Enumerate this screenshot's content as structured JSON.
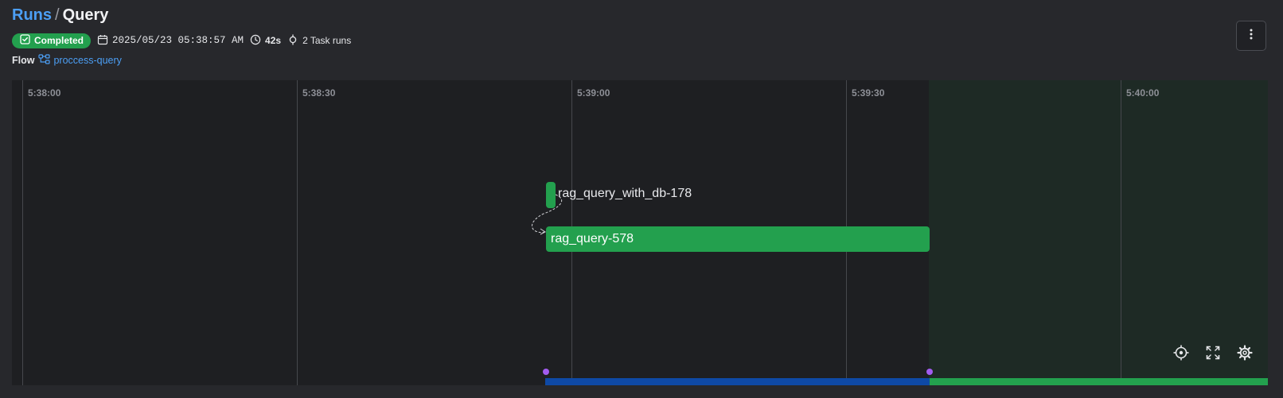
{
  "breadcrumb": {
    "parent": "Runs",
    "separator": "/",
    "current": "Query"
  },
  "run": {
    "state": "Completed",
    "start_time": "2025/05/23 05:38:57 AM",
    "duration": "42s",
    "task_runs": "2 Task runs"
  },
  "flow": {
    "label": "Flow",
    "name": "proccess-query"
  },
  "timeline": {
    "ticks": [
      "5:38:00",
      "5:38:30",
      "5:39:00",
      "5:39:30",
      "5:40:00"
    ],
    "nodes": [
      {
        "name": "rag_query_with_db-178",
        "state": "Completed"
      },
      {
        "name": "rag_query-578",
        "state": "Completed"
      }
    ]
  },
  "icons": {
    "badge": "check-square-icon",
    "date": "calendar-icon",
    "duration": "clock-icon",
    "tasks": "task-run-icon",
    "flow": "flow-icon",
    "menu": "kebab-menu-icon",
    "recenter": "crosshair-icon",
    "fullscreen": "fullscreen-icon",
    "settings": "gear-icon"
  },
  "colors": {
    "accent_link": "#4c9ff5",
    "completed": "#23a04e",
    "range_blue": "#0e49a6",
    "handle": "#a25cf0",
    "background": "#27282c",
    "timeline_bg": "#1e1f22"
  }
}
